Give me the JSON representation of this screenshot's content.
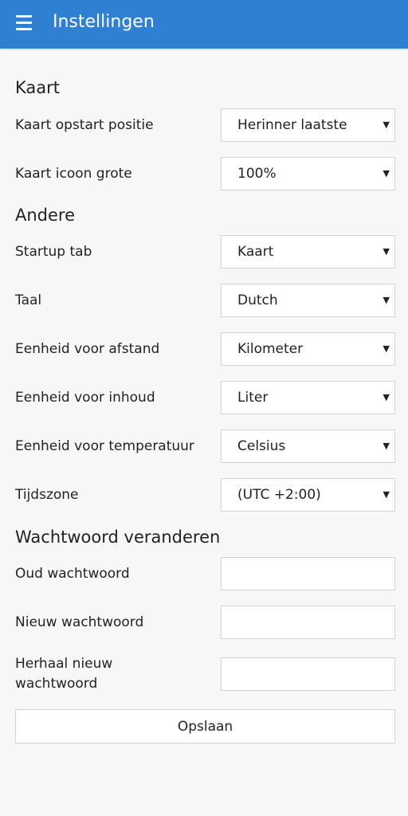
{
  "header": {
    "title": "Instellingen",
    "menu_icon": "hamburger-menu-icon"
  },
  "sections": {
    "map": "Kaart",
    "other": "Andere",
    "password": "Wachtwoord veranderen"
  },
  "map_settings": {
    "start_position": {
      "label": "Kaart opstart positie",
      "value": "Herinner laatste"
    },
    "icon_size": {
      "label": "Kaart icoon grote",
      "value": "100%"
    }
  },
  "other_settings": {
    "startup_tab": {
      "label": "Startup tab",
      "value": "Kaart"
    },
    "language": {
      "label": "Taal",
      "value": "Dutch"
    },
    "distance_unit": {
      "label": "Eenheid voor afstand",
      "value": "Kilometer"
    },
    "volume_unit": {
      "label": "Eenheid voor inhoud",
      "value": "Liter"
    },
    "temperature_unit": {
      "label": "Eenheid voor temperatuur",
      "value": "Celsius"
    },
    "timezone": {
      "label": "Tijdszone",
      "value": "(UTC +2:00)"
    }
  },
  "password_settings": {
    "old": {
      "label": "Oud wachtwoord",
      "value": ""
    },
    "new": {
      "label": "Nieuw wachtwoord",
      "value": ""
    },
    "repeat": {
      "label": "Herhaal nieuw wachtwoord",
      "value": ""
    }
  },
  "dropdown_arrow": "▼",
  "save_label": "Opslaan",
  "colors": {
    "app_bar": "#2f7fd3",
    "background": "#f7f7f7",
    "border": "#d3d3d3"
  }
}
